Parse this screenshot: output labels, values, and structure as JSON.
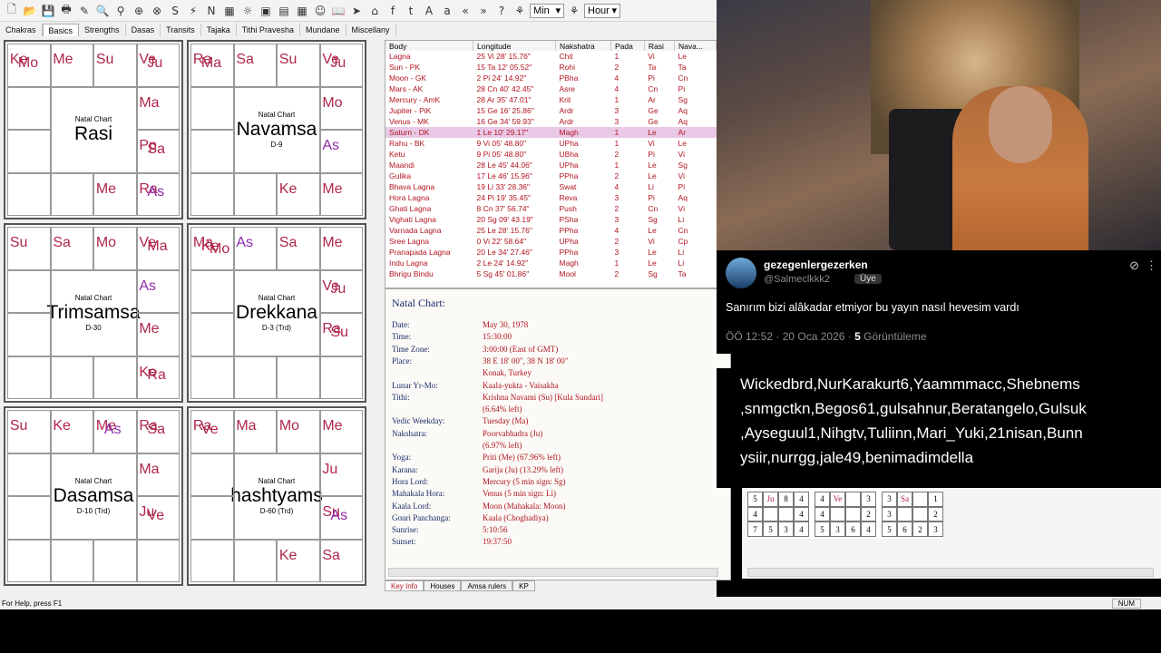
{
  "toolbar": {
    "time_unit_1": "Min",
    "time_unit_2": "Hour",
    "icons": [
      "new-icon",
      "open-icon",
      "save-icon",
      "print-icon",
      "edit-chart-icon",
      "search-data-icon",
      "zoom-icon",
      "wheel-icon",
      "chart-wheel-icon",
      "sp-icon",
      "bolt-icon",
      "n-icon",
      "table-icon",
      "sun-icon",
      "sb-icon",
      "calendar-icon",
      "grid-icon",
      "people-icon",
      "book-icon",
      "forward-icon",
      "house-icon",
      "facebook-icon",
      "twitter-icon",
      "font-large-icon",
      "font-small-icon",
      "prev-icon",
      "next-icon",
      "help-icon",
      "transit-icon",
      "transit-2-icon"
    ]
  },
  "tabs": [
    "Chakras",
    "Basics",
    "Strengths",
    "Dasas",
    "Transits",
    "Tajaka",
    "Tithi Pravesha",
    "Mundane",
    "Miscellany"
  ],
  "charts": [
    {
      "top": "Natal Chart",
      "name": "Rasi",
      "sub": ""
    },
    {
      "top": "Natal Chart",
      "name": "Navamsa",
      "sub": "D-9"
    },
    {
      "top": "Natal Chart",
      "name": "Trimsamsa",
      "sub": "D-30"
    },
    {
      "top": "Natal Chart",
      "name": "Drekkana",
      "sub": "D-3 (Trd)"
    },
    {
      "top": "Natal Chart",
      "name": "Dasamsa",
      "sub": "D-10 (Trd)"
    },
    {
      "top": "Natal Chart",
      "name": "hashtyams",
      "sub": "D-60 (Trd)"
    }
  ],
  "chart_cells": {
    "rasi": {
      "c0": [
        "Ke",
        "Mo"
      ],
      "c1": [
        "Me"
      ],
      "c2": [
        "Su"
      ],
      "c3": [
        "Ve",
        "Ju"
      ],
      "c4": [
        "Ma"
      ],
      "c5": [
        "Pp",
        "Sa"
      ],
      "c6": [
        "Ra",
        "As"
      ],
      "c7": [
        "Me"
      ]
    },
    "navamsa": {
      "c0": [
        "Ra",
        "Ma"
      ],
      "c1": [
        "Sa"
      ],
      "c2": [
        "Su"
      ],
      "c3": [
        "Ve",
        "Ju"
      ],
      "c4": [
        "Mo"
      ],
      "c5": [
        "As"
      ],
      "c6": [
        "Me"
      ],
      "c7": [
        "Ke"
      ]
    },
    "trimsamsa": {
      "c0": [
        "Su"
      ],
      "c1": [
        "Sa"
      ],
      "c2": [
        "Mo"
      ],
      "c3": [
        "Ve",
        "Ma"
      ],
      "c4": [
        "As"
      ],
      "c5": [
        "Me"
      ],
      "c6": [
        "Ke",
        "Ra"
      ]
    },
    "drekkana": {
      "c0": [
        "Ma",
        "Ke",
        "Mo"
      ],
      "c1": [
        "As"
      ],
      "c2": [
        "Sa"
      ],
      "c3": [
        "Me"
      ],
      "c4": [
        "Ve",
        "Ju"
      ],
      "c5": [
        "Ra",
        "Su"
      ]
    },
    "dasamsa": {
      "c0": [
        "Su"
      ],
      "c1": [
        "Ke"
      ],
      "c2": [
        "Me",
        "As"
      ],
      "c3": [
        "Ra",
        "Sa"
      ],
      "c4": [
        "Ma"
      ],
      "c5": [
        "Ju",
        "Ve"
      ]
    },
    "shashtyamsa": {
      "c0": [
        "Ra",
        "Ve"
      ],
      "c1": [
        "Ma"
      ],
      "c2": [
        "Mo"
      ],
      "c3": [
        "Me"
      ],
      "c4": [
        "Ju"
      ],
      "c5": [
        "Su",
        "As"
      ],
      "c6": [
        "Sa"
      ],
      "c7": [
        "Ke"
      ]
    }
  },
  "planet_table": {
    "headers": [
      "Body",
      "Longitude",
      "Nakshatra",
      "Pada",
      "Rasi",
      "Nava..."
    ],
    "rows": [
      [
        "Lagna",
        "25 Vi 28' 15.76\"",
        "Chit",
        "1",
        "Vi",
        "Le"
      ],
      [
        "Sun - PK",
        "15 Ta 12' 05.52\"",
        "Rohi",
        "2",
        "Ta",
        "Ta"
      ],
      [
        "Moon - GK",
        "2 Pi 24' 14.92\"",
        "PBha",
        "4",
        "Pi",
        "Cn"
      ],
      [
        "Mars - AK",
        "28 Cn 40' 42.45\"",
        "Asre",
        "4",
        "Cn",
        "Pi"
      ],
      [
        "Mercury - AmK",
        "28 Ar 35' 47.01\"",
        "Krit",
        "1",
        "Ar",
        "Sg"
      ],
      [
        "Jupiter - PiK",
        "15 Ge 16' 25.86\"",
        "Ardr",
        "3",
        "Ge",
        "Aq"
      ],
      [
        "Venus - MK",
        "16 Ge 34' 59.93\"",
        "Ardr",
        "3",
        "Ge",
        "Aq"
      ],
      [
        "Saturn - DK",
        "1 Le 10' 29.17\"",
        "Magh",
        "1",
        "Le",
        "Ar"
      ],
      [
        "Rahu - BK",
        "9 Vi 05' 48.80\"",
        "UPha",
        "1",
        "Vi",
        "Le"
      ],
      [
        "Ketu",
        "9 Pi 05' 48.80\"",
        "UBha",
        "2",
        "Pi",
        "Vi"
      ],
      [
        "Maandi",
        "28 Le 45' 44.06\"",
        "UPha",
        "1",
        "Le",
        "Sg"
      ],
      [
        "Gulika",
        "17 Le 46' 15.96\"",
        "PPha",
        "2",
        "Le",
        "Vi"
      ],
      [
        "Bhava Lagna",
        "19 Li 33' 28.36\"",
        "Swat",
        "4",
        "Li",
        "Pi"
      ],
      [
        "Hora Lagna",
        "24 Pi 19' 35.45\"",
        "Reva",
        "3",
        "Pi",
        "Aq"
      ],
      [
        "Ghati Lagna",
        "8 Cn 37' 56.74\"",
        "Push",
        "2",
        "Cn",
        "Vi"
      ],
      [
        "Vighati Lagna",
        "20 Sg 09' 43.19\"",
        "PSha",
        "3",
        "Sg",
        "Li"
      ],
      [
        "Varnada Lagna",
        "25 Le 28' 15.76\"",
        "PPha",
        "4",
        "Le",
        "Cn"
      ],
      [
        "Sree Lagna",
        "0 Vi 22' 58.64\"",
        "UPha",
        "2",
        "Vi",
        "Cp"
      ],
      [
        "Pranapada Lagna",
        "20 Le 34' 27.46\"",
        "PPha",
        "3",
        "Le",
        "Li"
      ],
      [
        "Indu Lagna",
        "2 Le 24' 14.92\"",
        "Magh",
        "1",
        "Le",
        "Li"
      ],
      [
        "Bhrigu Bindu",
        "5 Sg 45' 01.86\"",
        "Mool",
        "2",
        "Sg",
        "Ta"
      ]
    ],
    "selected_index": 7
  },
  "key_info": {
    "title": "Natal Chart:",
    "rows": [
      {
        "label": "Date:",
        "value": "May 30, 1978"
      },
      {
        "label": "Time:",
        "value": "15:30:00"
      },
      {
        "label": "Time Zone:",
        "value": "3:00:00 (East of GMT)"
      },
      {
        "label": "Place:",
        "value": "38 E 18' 00\", 38 N 18' 00\""
      },
      {
        "label": "",
        "value": "Konak, Turkey"
      },
      {
        "label": "Lunar Yr-Mo:",
        "value": "Kaala-yukta - Vaisakha"
      },
      {
        "label": "Tithi:",
        "value": "Krishna Navami (Su) [Kula Sundari]"
      },
      {
        "label": "",
        "value": "(6.64% left)"
      },
      {
        "label": "Vedic Weekday:",
        "value": "Tuesday (Ma)"
      },
      {
        "label": "Nakshatra:",
        "value": "Poorvabhadra (Ju)"
      },
      {
        "label": "",
        "value": "(6.97% left)"
      },
      {
        "label": "Yoga:",
        "value": "Priti (Me) (67.96% left)"
      },
      {
        "label": "Karana:",
        "value": "Garija (Ju) (13.29% left)"
      },
      {
        "label": "Hora Lord:",
        "value": "Mercury (5 min sign: Sg)"
      },
      {
        "label": "Mahakala Hora:",
        "value": "Venus (5 min sign: Li)"
      },
      {
        "label": "Kaala Lord:",
        "value": "Moon (Mahakala: Moon)"
      },
      {
        "label": "Gouri Panchanga:",
        "value": "Kaala (Choghadiya)"
      },
      {
        "label": "Sunrise:",
        "value": "5:10:56"
      },
      {
        "label": "Sunset:",
        "value": "19:37:50"
      }
    ]
  },
  "bottom_tabs": [
    "Key Info",
    "Houses",
    "Amsa rulers",
    "KP"
  ],
  "status": {
    "help": "For Help, press F1",
    "num": "NUM"
  },
  "tweet": {
    "username": "gezegenlergezerken",
    "handle": "@Salmeclkkk2",
    "badge": "Üye",
    "text": "Sanırım bizi alâkadar etmiyor bu yayın nasıl hevesim vardı",
    "time": "ÖÖ 12:52 · 20 Oca 2026 ·",
    "views_count": "5",
    "views_label": "Görüntüleme"
  },
  "names_overlay": "Wickedbrd,NurKarakurt6,Yaammmacc,Shebnems ,snmgctkn,Begos61,gulsahnur,Beratangelo,Gulsuk ,Ayseguul1,Nihgtv,Tuliinn,Mari_Yuki,21nisan,Bunn ysiir,nurrgg,jale49,benimadimdella",
  "mini_tables": [
    {
      "cells": [
        "5",
        "Ju",
        "8",
        "4",
        "4",
        "",
        "",
        "4",
        "7",
        "5",
        "3",
        "4"
      ]
    },
    {
      "cells": [
        "4",
        "Ve",
        "",
        "3",
        "4",
        "",
        "",
        "2",
        "5",
        "3",
        "6",
        "4"
      ]
    },
    {
      "cells": [
        "3",
        "Sa",
        "",
        "1",
        "3",
        "",
        "",
        "2",
        "5",
        "6",
        "2",
        "3"
      ]
    }
  ],
  "colors": {
    "planet_red": "#b0264a",
    "planet_purple": "#8e2aa8",
    "table_red": "#b21420",
    "label_blue": "#1c2a6b",
    "selected_row": "#e9c9e6"
  }
}
